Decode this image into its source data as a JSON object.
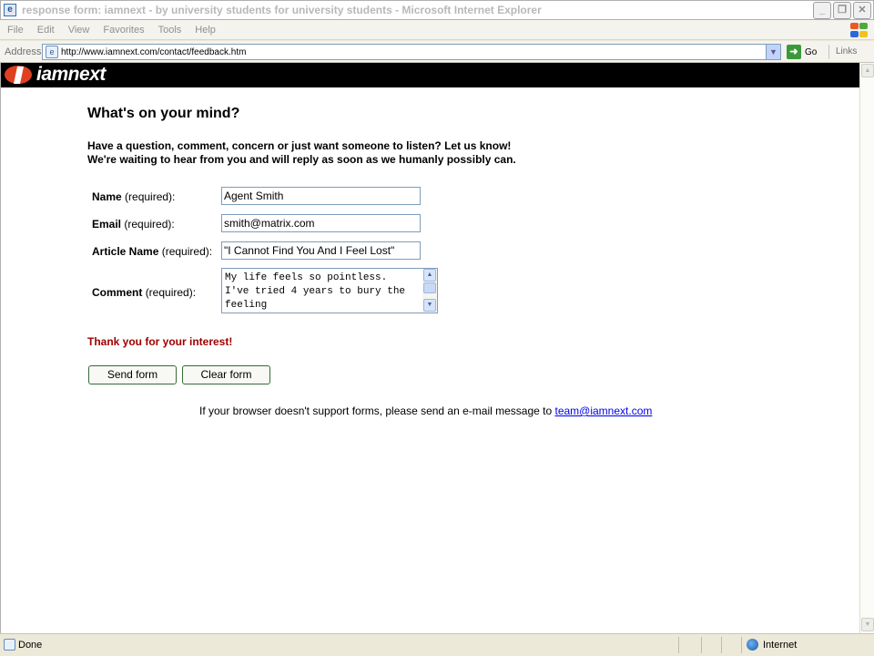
{
  "window": {
    "title": "response form: iamnext - by university students for university students - Microsoft Internet Explorer"
  },
  "menu": [
    "File",
    "Edit",
    "View",
    "Favorites",
    "Tools",
    "Help"
  ],
  "address": {
    "label": "Address",
    "url": "http://www.iamnext.com/contact/feedback.htm",
    "go_label": "Go",
    "links_label": "Links"
  },
  "site": {
    "logo_text": "iamnext"
  },
  "page": {
    "heading": "What's on your mind?",
    "intro_line1": "Have a question, comment, concern or just want someone to listen? Let us know!",
    "intro_line2": "We're waiting to hear from you and will reply as soon as we humanly possibly can."
  },
  "form": {
    "name": {
      "label": "Name",
      "req": "(required):",
      "value": "Agent Smith"
    },
    "email": {
      "label": "Email",
      "req": "(required):",
      "value": "smith@matrix.com"
    },
    "article": {
      "label": "Article Name",
      "req": "(required):",
      "value": "\"I Cannot Find You And I Feel Lost\""
    },
    "comment": {
      "label": "Comment",
      "req": "(required):",
      "value": "My life feels so pointless.  I've tried 4 years to bury the feeling"
    },
    "thanks": "Thank you for your interest!",
    "send_label": "Send form",
    "clear_label": "Clear form"
  },
  "footer": {
    "note": "If your browser doesn't support forms, please send an e-mail message to ",
    "email_link": "team@iamnext.com"
  },
  "status": {
    "text": "Done",
    "zone": "Internet"
  },
  "colors": {
    "thanks_red": "#a00000",
    "logo_orange": "#e04020",
    "link_blue": "#0000ee"
  }
}
